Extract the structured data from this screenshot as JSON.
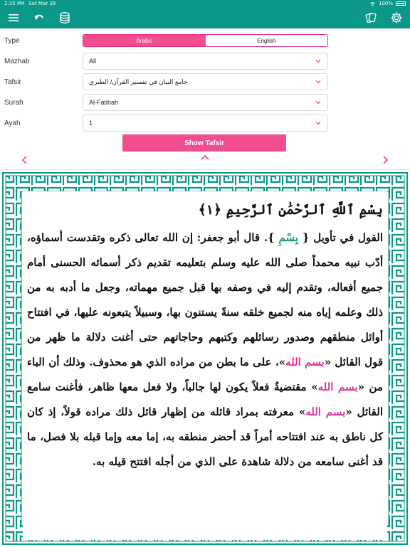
{
  "status_bar": {
    "time": "2:35 PM",
    "date": "Sat Mar 28",
    "battery": "100%",
    "battery_level": 1.0
  },
  "colors": {
    "toolbar": "#0c9888",
    "accent_pink": "#f14d8f",
    "border_teal": "#0c9888",
    "green_text": "#1aa068",
    "pink_text": "#e0339a"
  },
  "toolbar": {
    "left_icons": [
      "menu-icon",
      "undo-icon",
      "database-icon"
    ],
    "right_icons": [
      "cards-icon",
      "gear-icon"
    ]
  },
  "form": {
    "type": {
      "label": "Type",
      "options": [
        "Arabic",
        "English"
      ],
      "selected": "Arabic"
    },
    "mazhab": {
      "label": "Mazhab",
      "value": "All"
    },
    "tafsir": {
      "label": "Tafsir",
      "value": "جامع البيان في تفسير القرآن/ الطبري"
    },
    "surah": {
      "label": "Surah",
      "value": "Al-Fatihah"
    },
    "ayah": {
      "label": "Ayah",
      "value": "1"
    },
    "show_button": "Show Tafsir"
  },
  "content": {
    "ayah_text": "بِسْمِ ٱللَّهِ ٱلرَّحْمَٰنِ ٱلرَّحِيمِ ﴿١﴾",
    "t1": "القول في تأويل {",
    "t1_green": "بِسْمِ",
    "t2": "}. قال أبو جعفر: إن الله تعالى ذكره وتقدست أسماؤه، أدّب نبيه محمداً صلى الله عليه وسلم بتعليمه تقديم ذكر أسمائه الحسنى أمام جميع أفعاله، وتقدم إليه في وصفه بها قبل جميع مهماته، وجعل ما أدبه به من ذلك وعلمه إياه منه لجميع خلقه سنةً يستنون بها، وسبيلاً يتبعونه عليها، في افتتاح أوائل منطقهم وصدور رسائلهم وكتبهم وحاجاتهم حتى أغنت دلالة ما ظهر من قول القائل «",
    "p1": "بسم الله",
    "t3": "»، على ما بطن من مراده الذي هو محذوف. وذلك أن الباء من «",
    "p2": "بسم الله",
    "t4": "» مقتضيةٌ فعلاً يكون لها جالباً، ولا فعل معها ظاهر، فأغنت سامع القائل «",
    "p3": "بسم الله",
    "t5": "» معرفته بمراد قائله من إظهار قائل ذلك مراده قولاً، إذ كان كل ناطق به عند افتتاحه أمراً قد أحضر منطقه به، إما معه وإما قبله بلا فصل، ما قد أغنى سامعه من دلالة شاهدة على الذي من أجله افتتح قيله به."
  }
}
